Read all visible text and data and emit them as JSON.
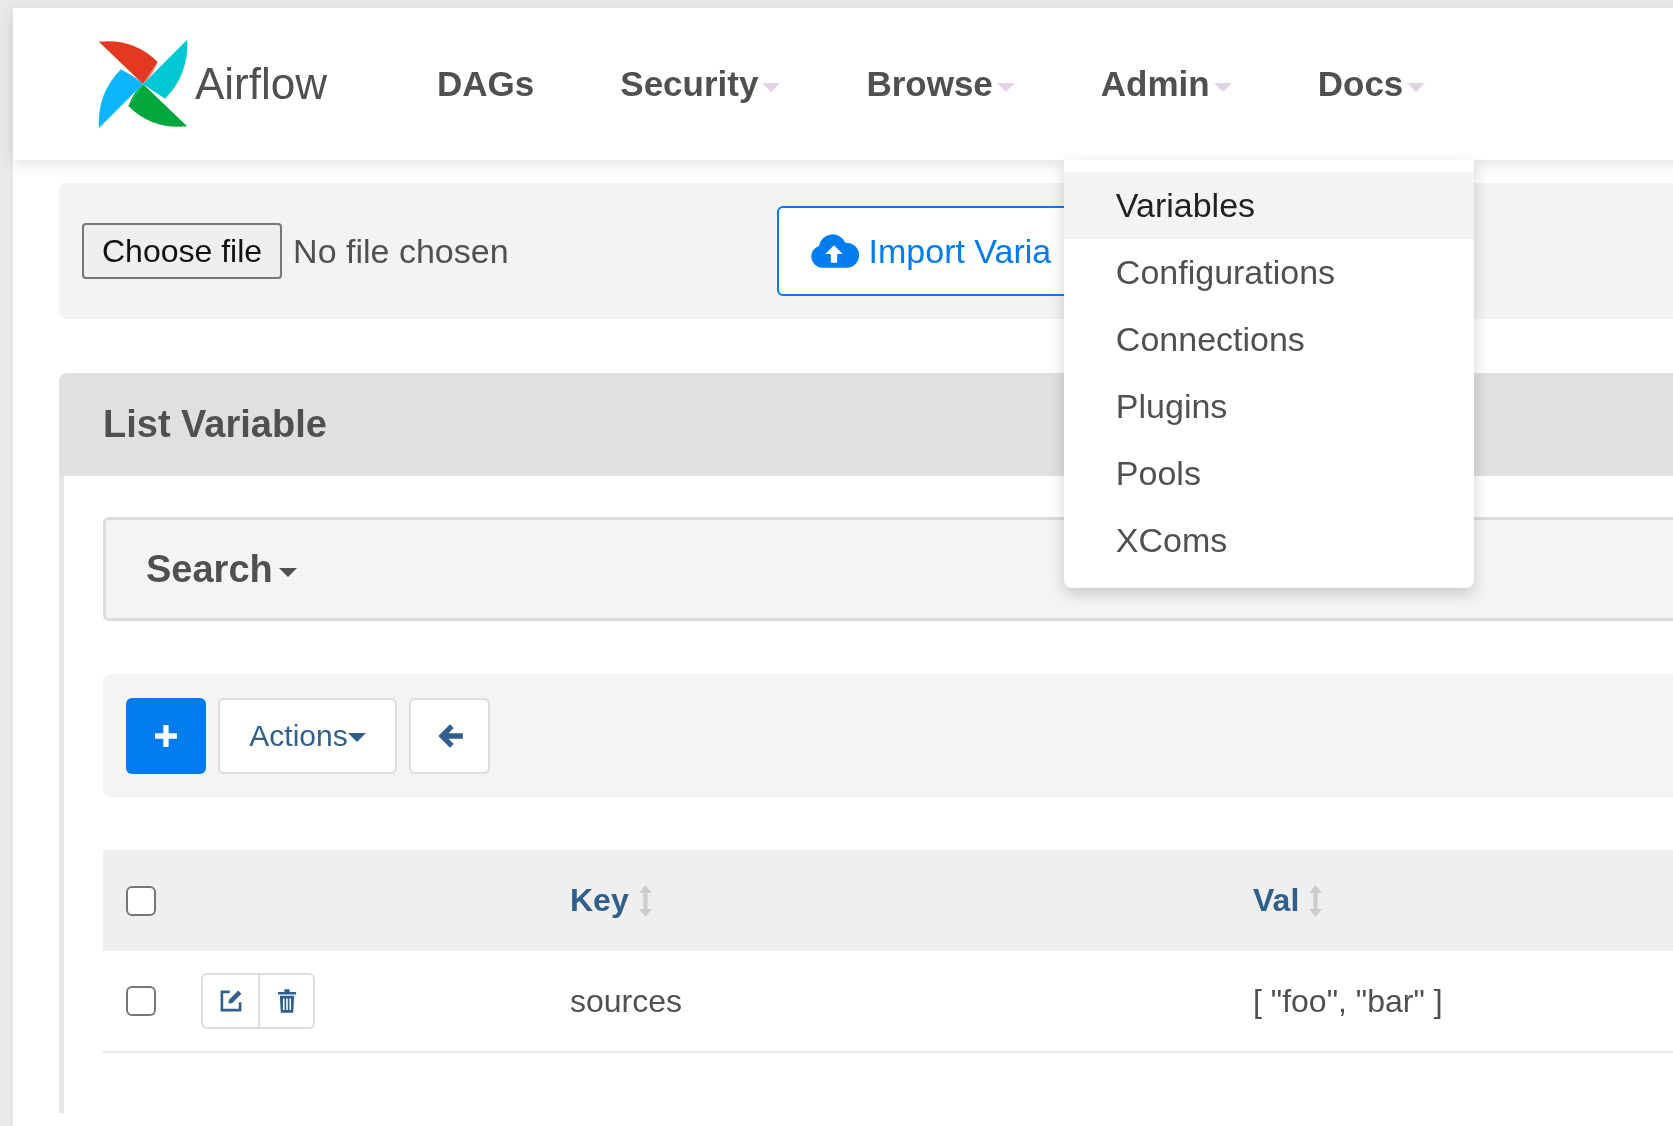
{
  "brand": {
    "name": "Airflow"
  },
  "nav": [
    {
      "label": "DAGs",
      "dropdown": false
    },
    {
      "label": "Security",
      "dropdown": true
    },
    {
      "label": "Browse",
      "dropdown": true
    },
    {
      "label": "Admin",
      "dropdown": true,
      "menu": [
        {
          "label": "Variables",
          "selected": true
        },
        {
          "label": "Configurations",
          "selected": false
        },
        {
          "label": "Connections",
          "selected": false
        },
        {
          "label": "Plugins",
          "selected": false
        },
        {
          "label": "Pools",
          "selected": false
        },
        {
          "label": "XComs",
          "selected": false
        }
      ]
    },
    {
      "label": "Docs",
      "dropdown": true
    }
  ],
  "import": {
    "choose_button": "Choose file",
    "file_status": "No file chosen",
    "import_button": "Import Varia"
  },
  "panel": {
    "title": "List Variable",
    "search_label": "Search",
    "actions_label": "Actions"
  },
  "table": {
    "select_all_checked": false,
    "columns": [
      "Key",
      "Val"
    ],
    "rows": [
      {
        "checked": false,
        "cells": [
          "sources",
          "[ \"foo\", \"bar\" ]"
        ]
      }
    ]
  }
}
